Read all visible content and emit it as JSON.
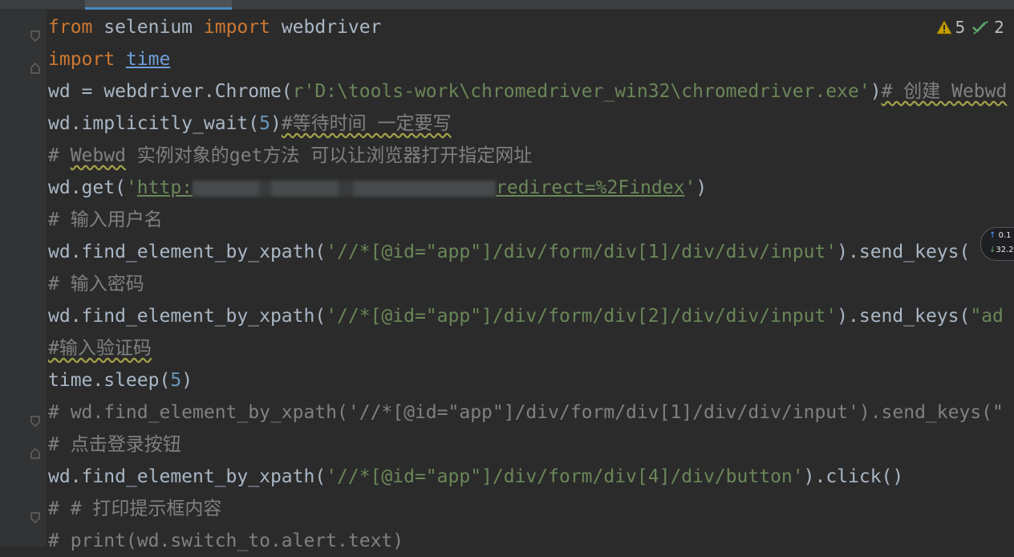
{
  "inspections": {
    "warnings": "5",
    "passed": "2"
  },
  "network": {
    "up": "0.1",
    "down": "32.2"
  },
  "code": {
    "l1": {
      "a": "from",
      "b": " selenium ",
      "c": "import",
      "d": " webdriver"
    },
    "l2": {
      "a": "import",
      "b": " ",
      "c": "time"
    },
    "l3": {
      "a": "wd = webdriver.Chrome(",
      "b": "r'D:\\tools-work\\chromedriver_win32\\chromedriver.exe'",
      "c": ")",
      "d": "# 创建 Webwd"
    },
    "l4": {
      "a": "wd.implicitly_wait(",
      "b": "5",
      "c": ")",
      "d": "#等待时间 一定要写"
    },
    "l5": {
      "a": "# ",
      "b": "Webwd",
      "c": " 实例对象的get方法 可以让浏览器打开指定网址"
    },
    "l6": {
      "a": "wd.get(",
      "b": "'",
      "c": "http:",
      "d": "redirect=%2Findex",
      "e": "'",
      "f": ")"
    },
    "l7": {
      "a": "# 输入用户名"
    },
    "l8": {
      "a": "wd.find_element_by_xpath(",
      "b": "'//*[@id=\"app\"]/div/form/div[1]/div/div/input'",
      "c": ").send_keys("
    },
    "l9": {
      "a": "# 输入密码"
    },
    "l10": {
      "a": "wd.find_element_by_xpath(",
      "b": "'//*[@id=\"app\"]/div/form/div[2]/div/div/input'",
      "c": ").send_keys(",
      "d": "\"ad"
    },
    "l11": {
      "a": "#输入验证码"
    },
    "l12": {
      "a": "time.sleep(",
      "b": "5",
      "c": ")"
    },
    "l13": {
      "a": "# wd.find_element_by_xpath('//*[@id=\"app\"]/div/form/div[1]/div/div/input').send_keys(\""
    },
    "l14": {
      "a": "# 点击登录按钮"
    },
    "l15": {
      "a": "wd.find_element_by_xpath(",
      "b": "'//*[@id=\"app\"]/div/form/div[4]/div/button'",
      "c": ").click()"
    },
    "l16": {
      "a": "# # 打印提示框内容"
    },
    "l17": {
      "a": "# print(wd.switch_to.alert.text)"
    }
  }
}
